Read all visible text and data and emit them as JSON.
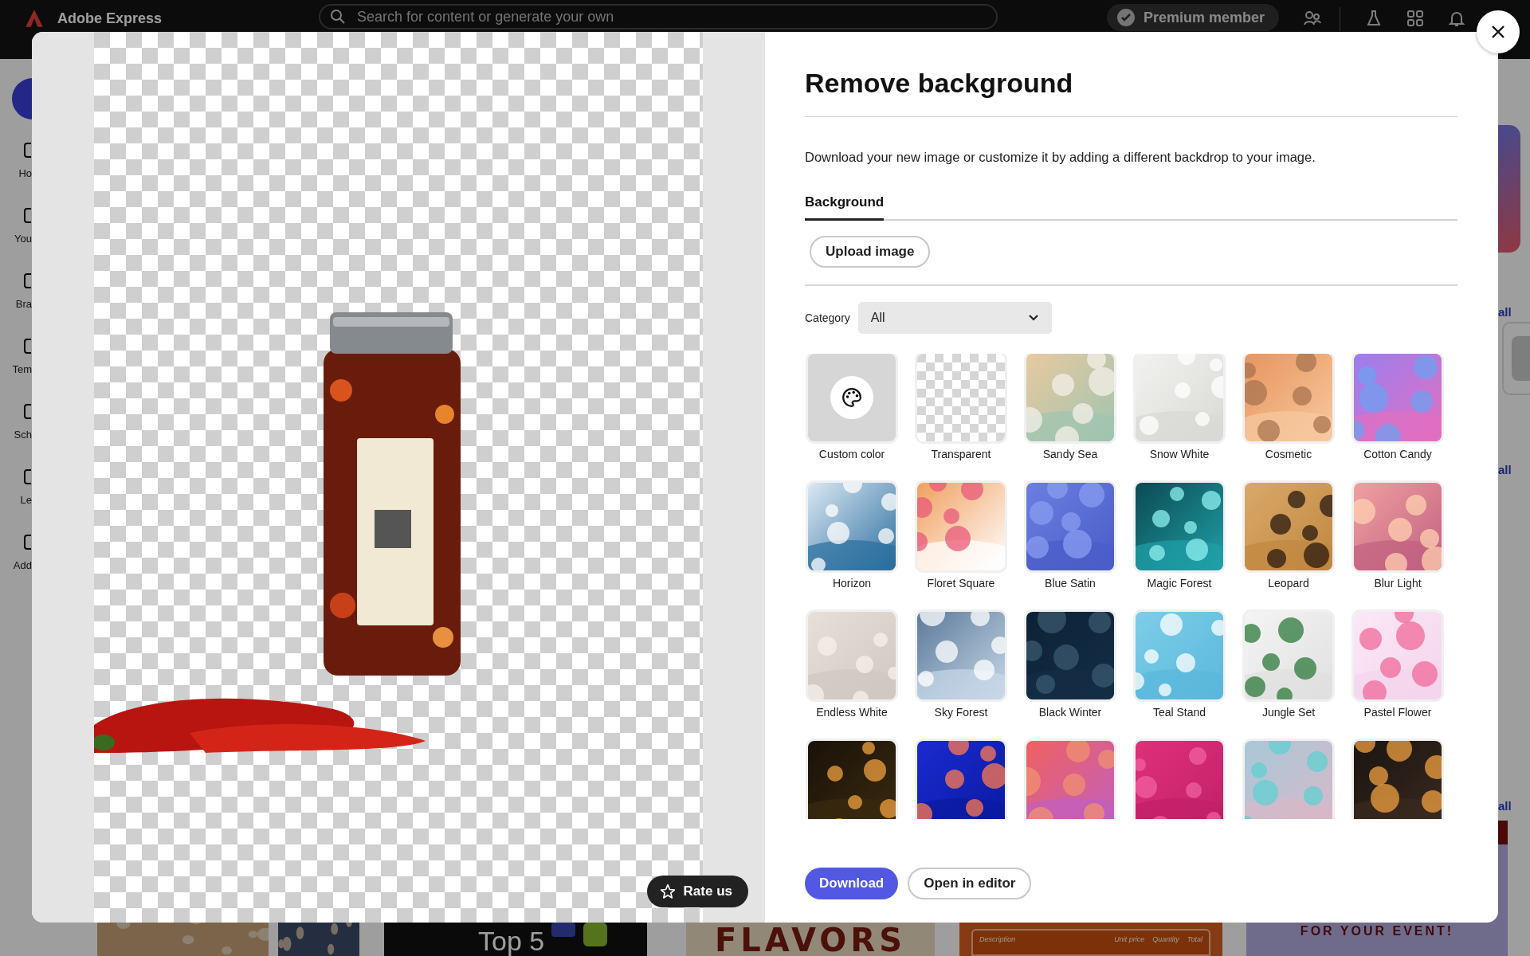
{
  "app_bar": {
    "logo": "Adobe Express",
    "search": {
      "placeholder": "Search for content or generate your own"
    },
    "premium_badge": "Premium member"
  },
  "sidebar": {
    "items": [
      {
        "label": "Ho"
      },
      {
        "label": "You"
      },
      {
        "label": "Bra"
      },
      {
        "label": "Tem"
      },
      {
        "label": "Sch"
      },
      {
        "label": "Le"
      },
      {
        "label": "Add"
      }
    ]
  },
  "page_links": [
    "all",
    "all",
    "all"
  ],
  "page_cards": [
    {
      "kind": "picture"
    },
    {
      "kind": "picture"
    },
    {
      "kind": "video",
      "title": "Top 5"
    },
    {
      "kind": "poster",
      "title": "FLAVORS"
    },
    {
      "kind": "invoice",
      "columns": [
        "Description",
        "Unit price",
        "Quantity",
        "Total"
      ]
    },
    {
      "kind": "flyer",
      "title": "FOR YOUR EVENT!"
    }
  ],
  "dialog": {
    "preview": {
      "kind": "picture",
      "rate_button": "Rate us"
    },
    "title": "Remove background",
    "description": "Download your new image or customize it by adding a different backdrop to your image.",
    "tabs": [
      {
        "label": "Background",
        "selected": true
      }
    ],
    "upload_button": "Upload image",
    "category": {
      "label": "Category",
      "value": "All"
    },
    "backdrops": [
      {
        "kind": "custom",
        "label": "Custom color"
      },
      {
        "kind": "transparent",
        "label": "Transparent"
      },
      {
        "kind": "picture",
        "label": "Sandy Sea"
      },
      {
        "kind": "picture",
        "label": "Snow White"
      },
      {
        "kind": "picture",
        "label": "Cosmetic"
      },
      {
        "kind": "picture",
        "label": "Cotton Candy"
      },
      {
        "kind": "picture",
        "label": "Horizon"
      },
      {
        "kind": "picture",
        "label": "Floret Square"
      },
      {
        "kind": "picture",
        "label": "Blue Satin"
      },
      {
        "kind": "picture",
        "label": "Magic Forest"
      },
      {
        "kind": "picture",
        "label": "Leopard"
      },
      {
        "kind": "picture",
        "label": "Blur Light"
      },
      {
        "kind": "picture",
        "label": "Endless White"
      },
      {
        "kind": "picture",
        "label": "Sky Forest"
      },
      {
        "kind": "picture",
        "label": "Black Winter"
      },
      {
        "kind": "picture",
        "label": "Teal Stand"
      },
      {
        "kind": "picture",
        "label": "Jungle Set"
      },
      {
        "kind": "picture",
        "label": "Pastel Flower"
      },
      {
        "kind": "picture"
      },
      {
        "kind": "picture"
      },
      {
        "kind": "picture"
      },
      {
        "kind": "picture"
      },
      {
        "kind": "picture"
      },
      {
        "kind": "picture"
      }
    ],
    "buttons": [
      {
        "kind": "primary",
        "label": "Download"
      },
      {
        "kind": "secondary",
        "label": "Open in editor"
      }
    ]
  }
}
